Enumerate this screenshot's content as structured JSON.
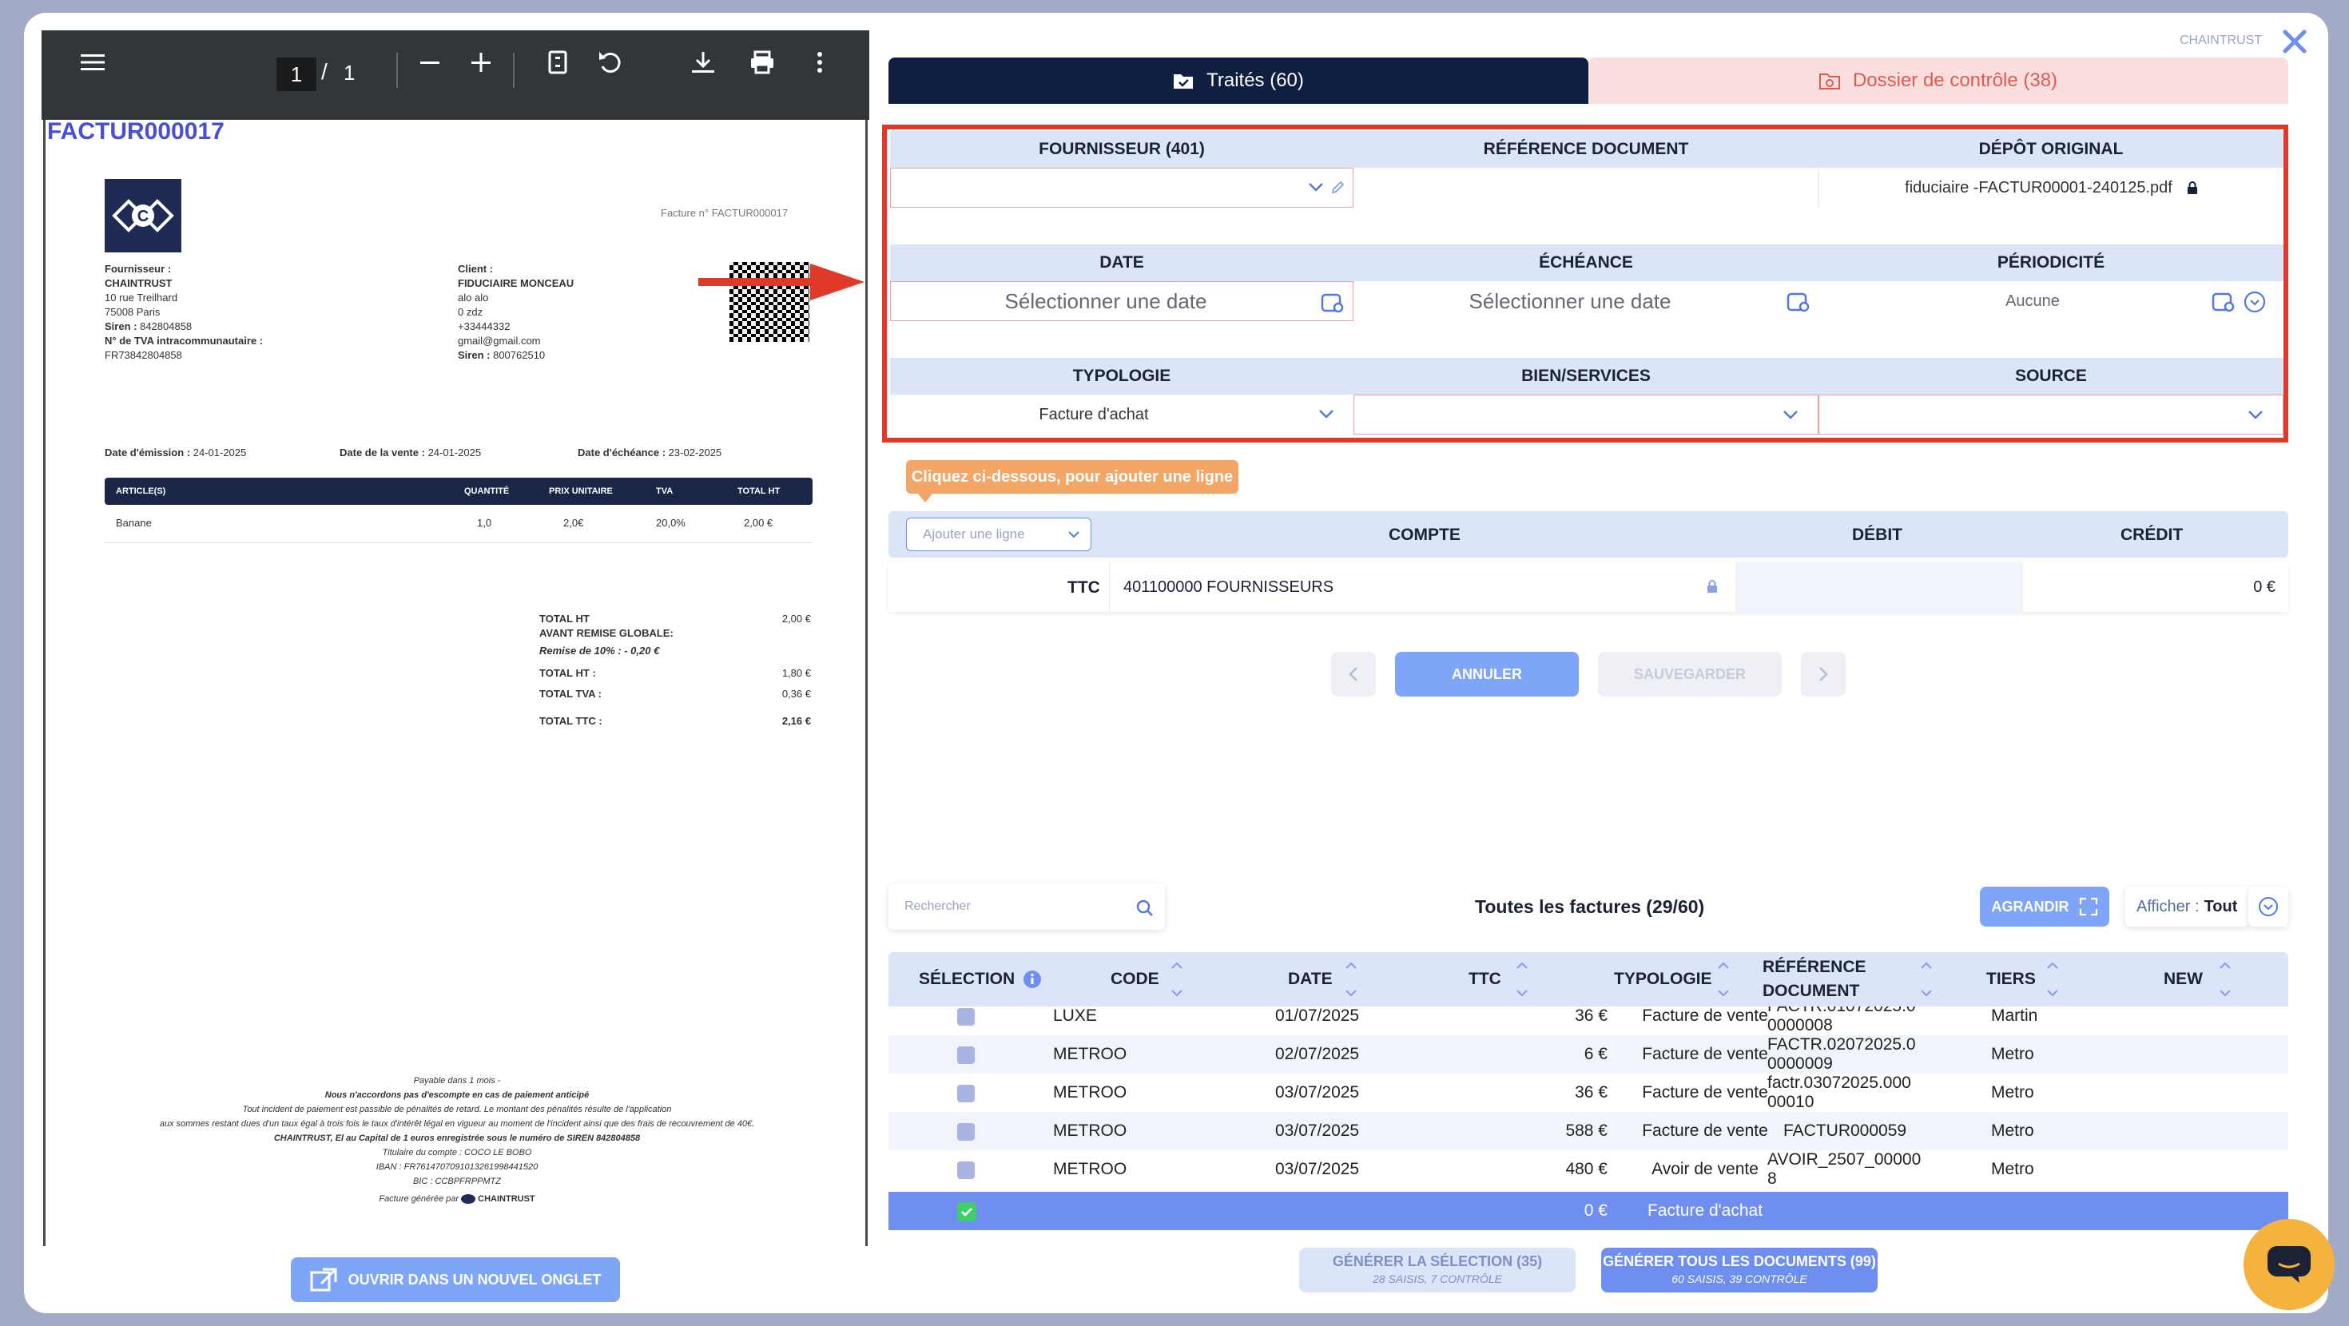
{
  "pdf_viewer": {
    "page_current": "1",
    "page_sep": "/",
    "page_total": "1"
  },
  "invoice": {
    "doc_title": "FACTUR000017",
    "header_ref": "Facture n° FACTUR000017",
    "supplier": {
      "label": "Fournisseur :",
      "name": "CHAINTRUST",
      "address1": "10 rue Treilhard",
      "address2": "75008 Paris",
      "siren_label": "Siren :",
      "siren": "842804858",
      "tva_label": "N° de TVA intracommunautaire :",
      "tva": "FR73842804858"
    },
    "client": {
      "label": "Client :",
      "name": "FIDUCIAIRE MONCEAU",
      "line1": "alo alo",
      "line2": "0 zdz",
      "phone": "+33444332",
      "email": "gmail@gmail.com",
      "siren_label": "Siren :",
      "siren": "800762510"
    },
    "emission_label": "Date d'émission :",
    "emission": "24-01-2025",
    "sale_label": "Date de la vente :",
    "sale": "24-01-2025",
    "due_label": "Date d'échéance :",
    "due": "23-02-2025",
    "table_headers": [
      "ARTICLE(S)",
      "QUANTITÉ",
      "PRIX UNITAIRE",
      "TVA",
      "TOTAL HT"
    ],
    "lines": [
      {
        "article": "Banane",
        "qty": "1,0",
        "price": "2,0€",
        "tva": "20,0%",
        "total": "2,00 €"
      }
    ],
    "totals": {
      "ht_label": "TOTAL HT",
      "ht_value": "2,00 €",
      "before_discount": "AVANT REMISE GLOBALE:",
      "discount": "Remise de 10% : - 0,20 €",
      "ht2_label": "TOTAL HT :",
      "ht2_value": "1,80 €",
      "tva_label": "TOTAL TVA :",
      "tva_value": "0,36 €",
      "ttc_label": "TOTAL TTC :",
      "ttc_value": "2,16 €"
    },
    "footer": {
      "l1": "Payable dans 1 mois -",
      "l2": "Nous n'accordons pas d'escompte en cas de paiement anticipé",
      "l3": "Tout incident de paiement est passible de pénalités de retard. Le montant des pénalités résulte de l'application",
      "l4": "aux sommes restant dues d'un taux égal à trois fois le taux d'intérêt légal en vigueur au moment de l'incident ainsi que des frais de recouvrement de 40€.",
      "l5": "CHAINTRUST, El au Capital de 1 euros enregistrée sous le numéro de SIREN 842804858",
      "l6": "Titulaire du compte : COCO LE BOBO",
      "l7": "IBAN : FR7614707091013261998441520",
      "l8": "BIC : CCBPFRPPMTZ",
      "l9": "Facture générée par",
      "brand": "CHAINTRUST"
    }
  },
  "open_tab_button": "OUVRIR DANS UN NOUVEL ONGLET",
  "brand_label": "CHAINTRUST",
  "tabs": {
    "processed": "Traités (60)",
    "control": "Dossier de contrôle (38)"
  },
  "form": {
    "supplier_header": "FOURNISSEUR (401)",
    "reference_header": "RÉFÉRENCE DOCUMENT",
    "deposit_header": "DÉPÔT ORIGINAL",
    "deposit_value": "fiduciaire -FACTUR00001-240125.pdf",
    "date_header": "DATE",
    "date_placeholder": "Sélectionner une date",
    "due_header": "ÉCHÉANCE",
    "due_placeholder": "Sélectionner une date",
    "period_header": "PÉRIODICITÉ",
    "period_value": "Aucune",
    "typology_header": "TYPOLOGIE",
    "typology_value": "Facture d'achat",
    "goods_header": "BIEN/SERVICES",
    "source_header": "SOURCE"
  },
  "entries": {
    "tooltip": "Cliquez ci-dessous, pour ajouter une ligne",
    "add_line_placeholder": "Ajouter une ligne",
    "account_header": "COMPTE",
    "debit_header": "DÉBIT",
    "credit_header": "CRÉDIT",
    "row_label": "TTC",
    "row_account": "401100000 FOURNISSEURS",
    "row_credit": "0 €"
  },
  "actions": {
    "cancel": "ANNULER",
    "save": "SAUVEGARDER"
  },
  "invoices": {
    "search_placeholder": "Rechercher",
    "title": "Toutes les factures (29/60)",
    "expand": "AGRANDIR",
    "show_label": "Afficher :",
    "show_value": "Tout",
    "headers": {
      "selection": "SÉLECTION",
      "code": "CODE",
      "date": "DATE",
      "ttc": "TTC",
      "typology": "TYPOLOGIE",
      "reference_1": "RÉFÉRENCE",
      "reference_2": "DOCUMENT",
      "tiers": "TIERS",
      "new": "NEW"
    },
    "rows": [
      {
        "code": "LUXE",
        "date": "01/07/2025",
        "ttc": "36 €",
        "typology": "Facture de vente",
        "ref1": "FACTR.01072025.0",
        "ref2": "0000008",
        "tiers": "Martin"
      },
      {
        "code": "METROO",
        "date": "02/07/2025",
        "ttc": "6 €",
        "typology": "Facture de vente",
        "ref1": "FACTR.02072025.0",
        "ref2": "0000009",
        "tiers": "Metro"
      },
      {
        "code": "METROO",
        "date": "03/07/2025",
        "ttc": "36 €",
        "typology": "Facture de vente",
        "ref1": "factr.03072025.000",
        "ref2": "00010",
        "tiers": "Metro"
      },
      {
        "code": "METROO",
        "date": "03/07/2025",
        "ttc": "588 €",
        "typology": "Facture de vente",
        "ref1": "FACTUR000059",
        "ref2": "",
        "tiers": "Metro"
      },
      {
        "code": "METROO",
        "date": "03/07/2025",
        "ttc": "480 €",
        "typology": "Avoir de vente",
        "ref1": "AVOIR_2507_00000",
        "ref2": "8",
        "tiers": "Metro"
      }
    ],
    "selected_row": {
      "ttc": "0 €",
      "typology": "Facture d'achat"
    }
  },
  "generate": {
    "selection": "GÉNÉRER LA SÉLECTION (35)",
    "selection_sub": "28 SAISIS, 7 CONTRÔLE",
    "all": "GÉNÉRER TOUS LES DOCUMENTS (99)",
    "all_sub": "60 SAISIS, 39 CONTRÔLE"
  }
}
